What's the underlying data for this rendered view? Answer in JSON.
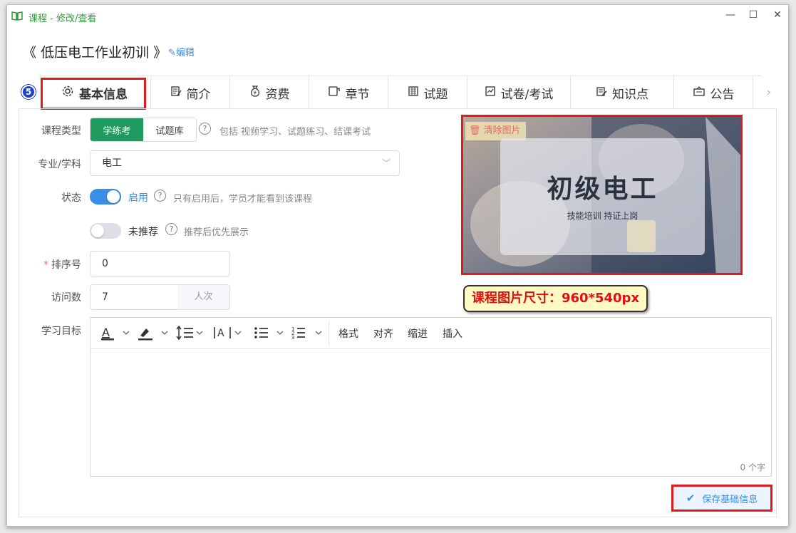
{
  "window": {
    "title": "课程 - 修改/查看",
    "icon": "book-icon",
    "controls": [
      "minimize-icon",
      "maximize-icon",
      "close-icon"
    ]
  },
  "course": {
    "title": "《 低压电工作业初训 》",
    "edit_label": "编辑"
  },
  "tabs": [
    {
      "label": "基本信息",
      "icon": "gear-icon",
      "active": true
    },
    {
      "label": "简介",
      "icon": "document-edit-icon"
    },
    {
      "label": "资费",
      "icon": "money-bag-icon"
    },
    {
      "label": "章节",
      "icon": "chapter-icon"
    },
    {
      "label": "试题",
      "icon": "question-bank-icon"
    },
    {
      "label": "试卷/考试",
      "icon": "exam-icon"
    },
    {
      "label": "知识点",
      "icon": "knowledge-icon"
    },
    {
      "label": "公告",
      "icon": "notice-icon"
    }
  ],
  "step_badge": "5",
  "form": {
    "course_type": {
      "label": "课程类型",
      "options": [
        "学练考",
        "试题库"
      ],
      "selected": "学练考",
      "hint": "包括 视频学习、试题练习、结课考试"
    },
    "major": {
      "label": "专业/学科",
      "value": "电工"
    },
    "status": {
      "label": "状态",
      "enabled_text": "启用",
      "enabled": true,
      "enabled_hint": "只有启用后，学员才能看到该课程",
      "recommend_text": "未推荐",
      "recommended": false,
      "recommend_hint": "推荐后优先展示"
    },
    "sort": {
      "label": "排序号",
      "value": "0",
      "required": true
    },
    "visits": {
      "label": "访问数",
      "value": "7",
      "unit": "人次"
    },
    "goal": {
      "label": "学习目标",
      "toolbar_menus": [
        "格式",
        "对齐",
        "缩进",
        "插入"
      ],
      "word_count": "0 个字"
    }
  },
  "image": {
    "clear_label": "清除图片",
    "title_text": "初级电工",
    "subtitle_text": "技能培训 持证上岗",
    "size_note": "课程图片尺寸：960*540px"
  },
  "save_label": "保存基础信息",
  "colors": {
    "primary_green": "#1f9b5f",
    "accent_blue": "#3a8ee6",
    "highlight_red": "#e01b1b"
  }
}
